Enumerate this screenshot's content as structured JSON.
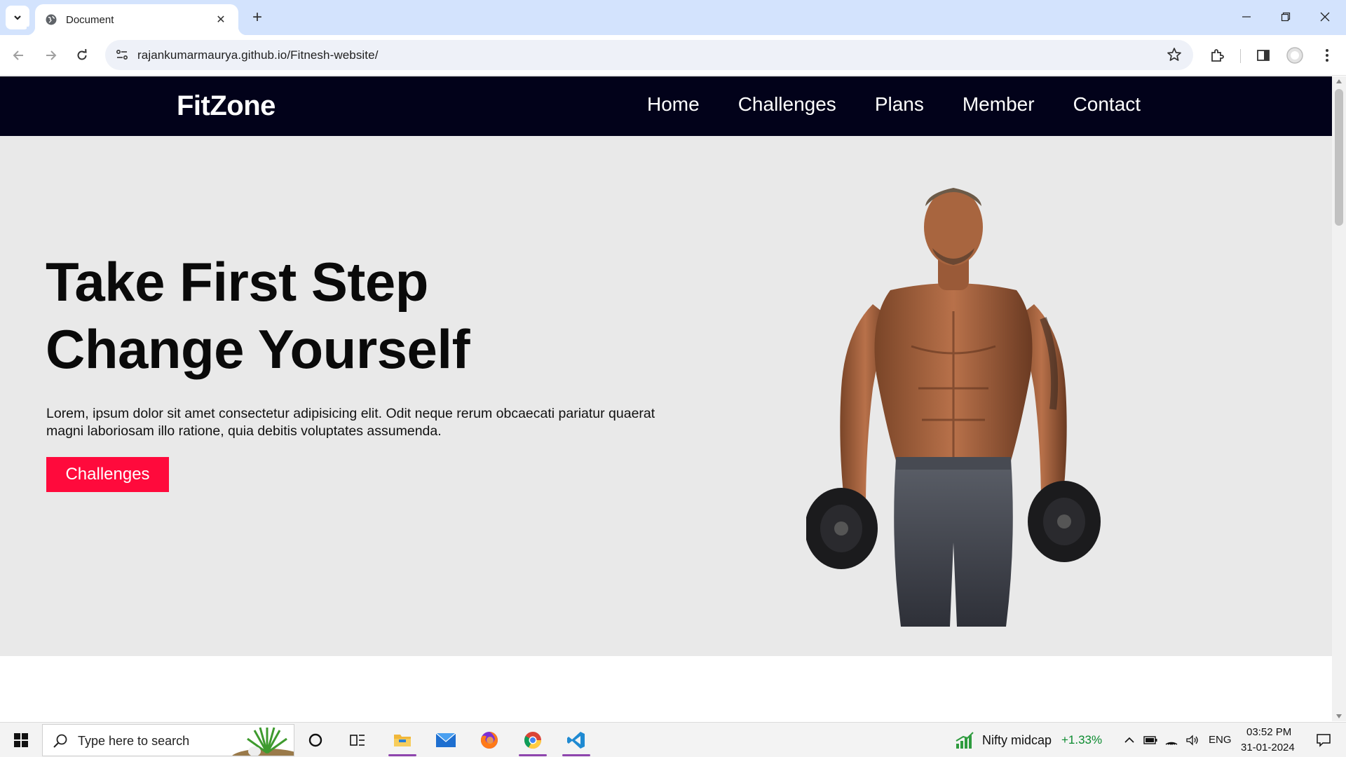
{
  "browser": {
    "tab_title": "Document",
    "url": "rajankumarmaurya.github.io/Fitnesh-website/"
  },
  "site": {
    "logo": "FitZone",
    "menu": [
      "Home",
      "Challenges",
      "Plans",
      "Member",
      "Contact"
    ],
    "hero": {
      "title_line1": "Take First Step",
      "title_line2": "Change Yourself",
      "text": "Lorem, ipsum dolor sit amet consectetur adipisicing elit. Odit neque rerum obcaecati pariatur quaerat magni laboriosam illo ratione, quia debitis voluptates assumenda.",
      "button": "Challenges"
    },
    "colors": {
      "nav_bg": "#02021a",
      "hero_bg": "#e9e9e9",
      "button_bg": "#ff0a3c"
    }
  },
  "taskbar": {
    "search_placeholder": "Type here to search",
    "stock_name": "Nifty midcap",
    "stock_change": "+1.33%",
    "language": "ENG",
    "time": "03:52 PM",
    "date": "31-01-2024"
  },
  "icons": {
    "tab": "globe-icon",
    "toolbar": [
      "back-icon",
      "forward-icon",
      "reload-icon",
      "site-info-icon",
      "star-icon",
      "extensions-icon",
      "sidepanel-icon",
      "profile-icon",
      "menu-icon"
    ],
    "taskbar": [
      "windows-icon",
      "search-icon",
      "cortana-icon",
      "task-view-icon",
      "file-explorer-icon",
      "mail-icon",
      "firefox-icon",
      "chrome-icon",
      "vscode-icon"
    ]
  }
}
